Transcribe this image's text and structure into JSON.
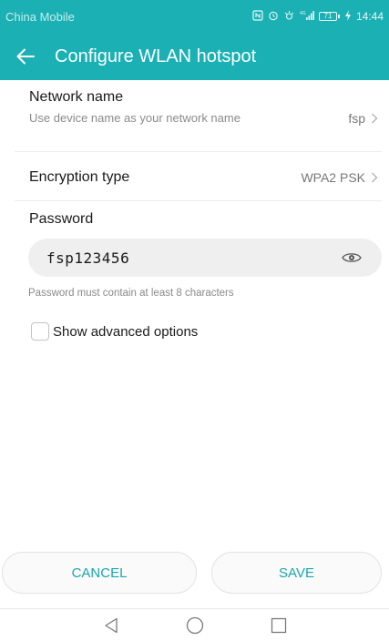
{
  "status_bar": {
    "carrier": "China Mobile",
    "battery": "71",
    "time": "14:44",
    "network_label": "4G"
  },
  "app_bar": {
    "title": "Configure WLAN hotspot"
  },
  "network_name": {
    "title": "Network name",
    "subtitle": "Use device name as your network name",
    "value": "fsp"
  },
  "encryption": {
    "title": "Encryption type",
    "value": "WPA2 PSK"
  },
  "password": {
    "label": "Password",
    "value": "fsp123456",
    "hint": "Password must contain at least 8 characters"
  },
  "advanced": {
    "label": "Show advanced options",
    "checked": false
  },
  "buttons": {
    "cancel": "CANCEL",
    "save": "SAVE"
  },
  "colors": {
    "accent": "#1ab0b4",
    "button_text": "#1aa6ac"
  }
}
